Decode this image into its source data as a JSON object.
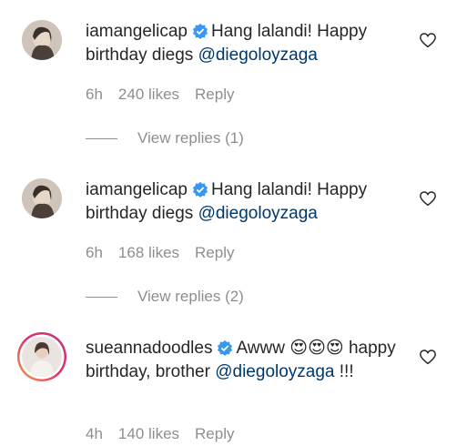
{
  "comments": [
    {
      "username": "iamangelicap",
      "text": "Hang lalandi! Happy birthday diegs ",
      "mention": "@diegoloyzaga",
      "time": "6h",
      "likes": "240 likes",
      "reply": "Reply",
      "view_replies": "View replies (1)"
    },
    {
      "username": "iamangelicap",
      "text": "Hang lalandi! Happy birthday diegs ",
      "mention": "@diegoloyzaga",
      "time": "6h",
      "likes": "168 likes",
      "reply": "Reply",
      "view_replies": "View replies (2)"
    },
    {
      "username": "sueannadoodles",
      "text_before": "Awww ",
      "emojis": [
        "😍",
        "😍",
        "😍"
      ],
      "text_after": " happy birthday, brother ",
      "mention": "@diegoloyzaga",
      "text_end": " !!!",
      "time": "4h",
      "likes": "140 likes",
      "reply": "Reply"
    }
  ],
  "colors": {
    "mention": "#00376b",
    "meta": "#8e8e8e",
    "verified": "#3897f0"
  }
}
